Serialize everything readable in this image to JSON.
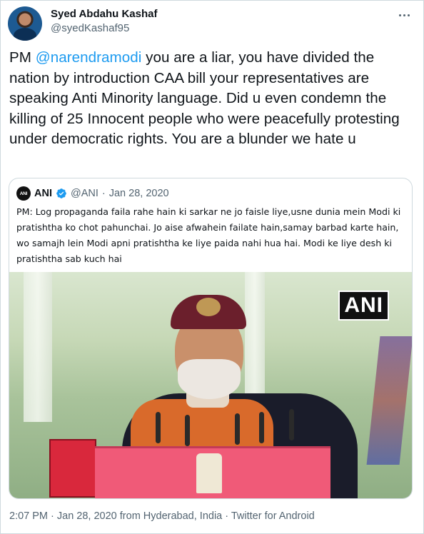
{
  "tweet": {
    "author": {
      "display_name": "Syed Abdahu Kashaf",
      "handle": "@syedKashaf95"
    },
    "text_prefix": "PM ",
    "mention": "@narendramodi",
    "text_body": " you are a liar, you have divided the nation by introduction CAA bill your representatives are speaking Anti Minority language. Did u even condemn the killing of 25 Innocent people who were peacefully protesting under democratic rights. You are a blunder we hate u",
    "more_icon": "more-dots-icon"
  },
  "quoted_tweet": {
    "avatar_text": "ANI",
    "name": "ANI",
    "verified_icon": "verified-badge-icon",
    "verified_color": "#1d9bf0",
    "handle": "@ANI",
    "separator": "·",
    "date": "Jan 28, 2020",
    "text": "PM: Log propaganda faila rahe hain ki sarkar ne jo faisle liye,usne dunia mein Modi ki pratishtha ko chot pahunchai. Jo aise afwahein failate hain,samay barbad karte hain, wo samajh lein Modi apni pratishtha ke liye paida nahi hua hai. Modi ke liye desh ki pratishtha sab kuch hai",
    "media_watermark": "ANI"
  },
  "footer": {
    "time": "2:07 PM",
    "separator": " · ",
    "date": "Jan 28, 2020",
    "location": " from Hyderabad, India",
    "client": "Twitter for Android"
  },
  "colors": {
    "link": "#1d9bf0",
    "secondary_text": "#536471",
    "border": "#cfd9de"
  }
}
